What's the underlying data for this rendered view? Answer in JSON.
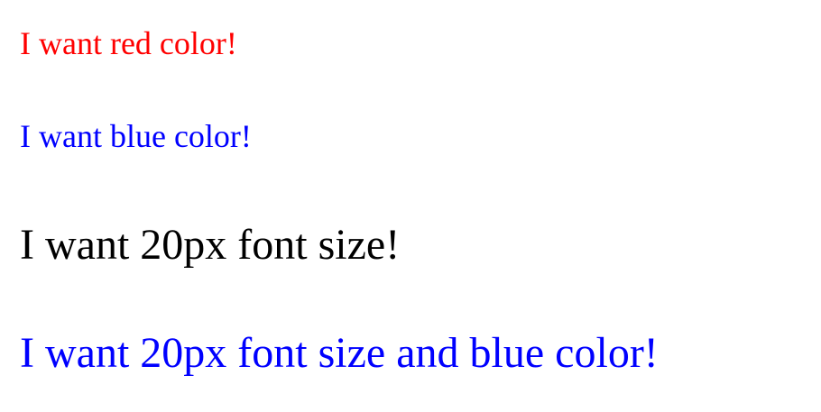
{
  "lines": [
    {
      "text": "I want red color!",
      "color": "#ff0000"
    },
    {
      "text": "I want blue color!",
      "color": "#0000ff"
    },
    {
      "text": "I want 20px font size!",
      "color": "#000000"
    },
    {
      "text": "I want 20px font size and blue color!",
      "color": "#0000ff"
    }
  ]
}
